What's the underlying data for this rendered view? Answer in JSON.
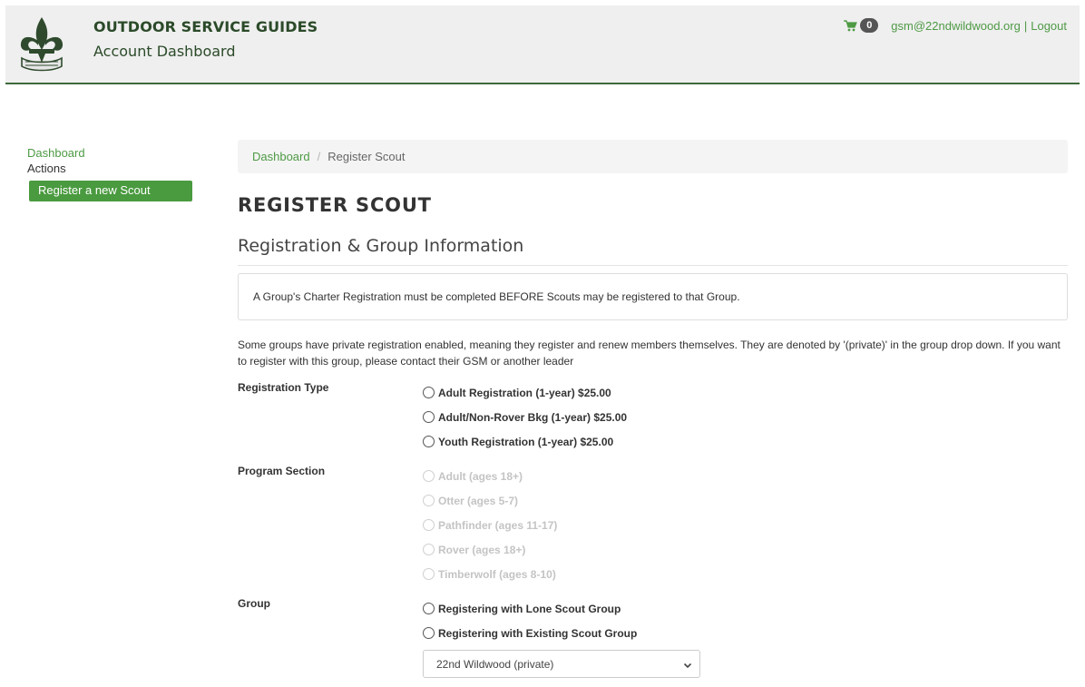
{
  "header": {
    "brand_title": "OUTDOOR SERVICE GUIDES",
    "brand_subtitle": "Account Dashboard",
    "cart_count": "0",
    "user_email": "gsm@22ndwildwood.org",
    "separator": "|",
    "logout_label": "Logout",
    "accent_color": "#3d6b3a"
  },
  "sidebar": {
    "dashboard_label": "Dashboard",
    "actions_label": "Actions",
    "register_label": "Register a new Scout"
  },
  "breadcrumb": {
    "items": [
      "Dashboard",
      "Register Scout"
    ],
    "separator": "/"
  },
  "page": {
    "title": "REGISTER SCOUT",
    "section_title": "Registration & Group Information",
    "notice": "A Group's Charter Registration must be completed BEFORE Scouts may be registered to that Group.",
    "info": "Some groups have private registration enabled, meaning they register and renew members themselves. They are denoted by '(private)' in the group drop down. If you want to register with this group, please contact their GSM or another leader"
  },
  "form": {
    "registration_type": {
      "label": "Registration Type",
      "options": [
        "Adult Registration (1-year) $25.00",
        "Adult/Non-Rover Bkg (1-year) $25.00",
        "Youth Registration (1-year) $25.00"
      ]
    },
    "program_section": {
      "label": "Program Section",
      "options": [
        "Adult (ages 18+)",
        "Otter (ages 5-7)",
        "Pathfinder (ages 11-17)",
        "Rover (ages 18+)",
        "Timberwolf (ages 8-10)"
      ]
    },
    "group": {
      "label": "Group",
      "options": [
        "Registering with Lone Scout Group",
        "Registering with Existing Scout Group"
      ],
      "selected_value": "22nd Wildwood (private)"
    }
  },
  "icons": {
    "logo": "fleur-de-lis-logo",
    "cart": "cart-icon",
    "select_arrow": "chevron-down-icon"
  }
}
